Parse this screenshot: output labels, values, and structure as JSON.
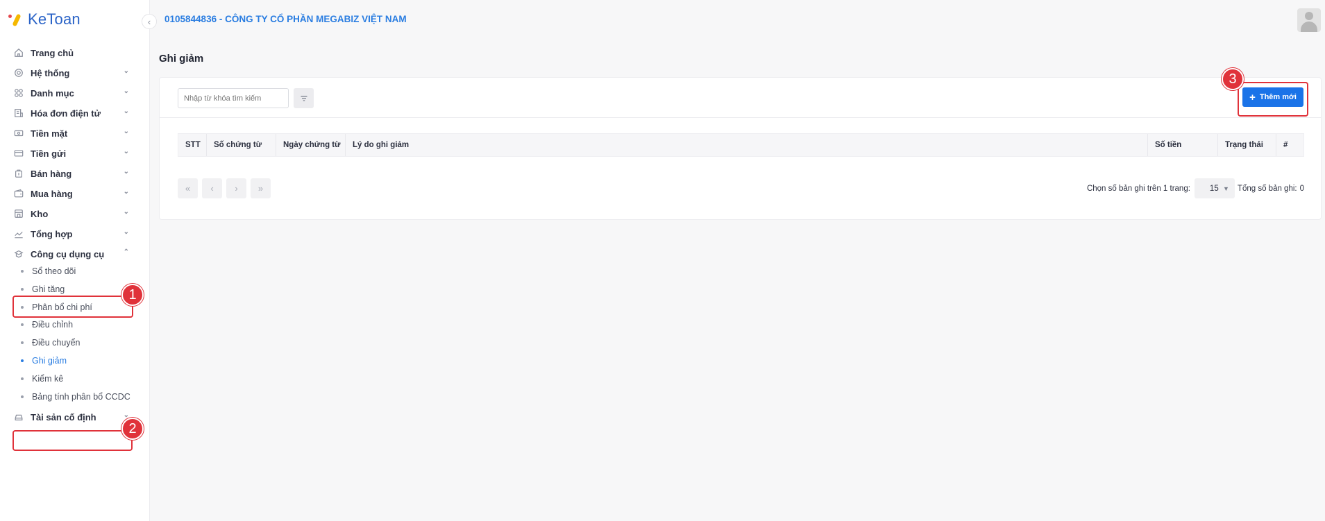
{
  "app": {
    "logo_text": "KeToan"
  },
  "header": {
    "company": "0105844836 - CÔNG TY CỔ PHẦN MEGABIZ VIỆT NAM"
  },
  "sidebar": {
    "items": [
      {
        "label": "Trang chủ",
        "icon": "home-icon"
      },
      {
        "label": "Hệ thống",
        "icon": "settings-icon"
      },
      {
        "label": "Danh mục",
        "icon": "grid-icon"
      },
      {
        "label": "Hóa đơn điện tử",
        "icon": "invoice-icon"
      },
      {
        "label": "Tiền mặt",
        "icon": "cash-icon"
      },
      {
        "label": "Tiền gửi",
        "icon": "card-icon"
      },
      {
        "label": "Bán hàng",
        "icon": "sales-icon"
      },
      {
        "label": "Mua hàng",
        "icon": "wallet-icon"
      },
      {
        "label": "Kho",
        "icon": "warehouse-icon"
      },
      {
        "label": "Tổng hợp",
        "icon": "chart-icon"
      },
      {
        "label": "Công cụ dụng cụ",
        "icon": "tools-icon"
      },
      {
        "label": "Tài sản cố định",
        "icon": "car-icon"
      }
    ],
    "sub_items": [
      {
        "label": "Sổ theo dõi"
      },
      {
        "label": "Ghi tăng"
      },
      {
        "label": "Phân bổ chi phí"
      },
      {
        "label": "Điều chỉnh"
      },
      {
        "label": "Điều chuyển"
      },
      {
        "label": "Ghi giảm"
      },
      {
        "label": "Kiểm kê"
      },
      {
        "label": "Bảng tính phân bổ CCDC"
      }
    ],
    "active_sub": "Ghi giảm"
  },
  "page": {
    "title": "Ghi giảm",
    "search_placeholder": "Nhập từ khóa tìm kiếm",
    "add_button": "Thêm mới",
    "columns": [
      "STT",
      "Số chứng từ",
      "Ngày chứng từ",
      "Lý do ghi giảm",
      "Số tiền",
      "Trạng thái",
      "#"
    ],
    "rows": []
  },
  "pagination": {
    "per_page_label": "Chọn số bản ghi trên 1 trang:",
    "per_page_value": "15",
    "total_label": "Tổng số bản ghi:",
    "total_value": "0"
  },
  "annotations": [
    "1",
    "2",
    "3"
  ],
  "colors": {
    "accent": "#1a73e8",
    "annotation": "#e0323a",
    "active_text": "#2a7de1"
  }
}
